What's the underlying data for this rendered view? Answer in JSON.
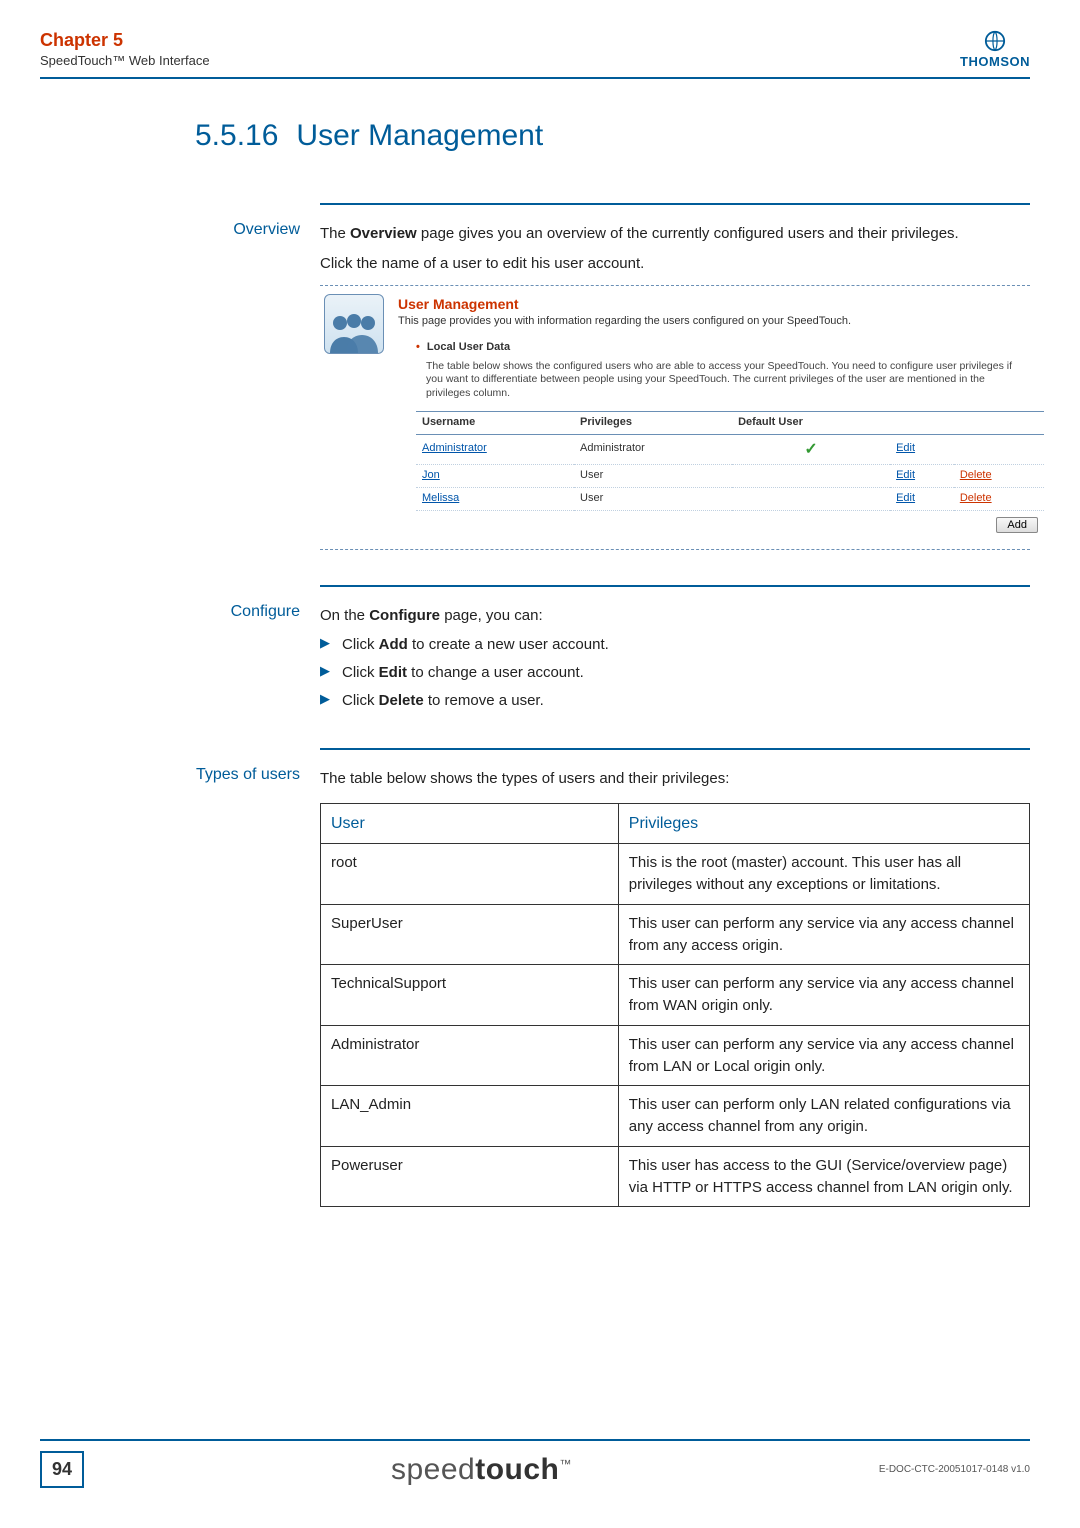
{
  "header": {
    "chapter": "Chapter 5",
    "subtitle": "SpeedTouch™ Web Interface",
    "logo_brand": "THOMSON"
  },
  "section": {
    "number": "5.5.16",
    "title": "User Management"
  },
  "overview": {
    "label": "Overview",
    "p1_prefix": "The ",
    "p1_bold": "Overview",
    "p1_suffix": " page gives you an overview of the currently configured users and their privileges.",
    "p2": "Click the name of a user to edit his user account."
  },
  "embed": {
    "title": "User Management",
    "sub": "This page provides you with information regarding the users configured on your SpeedTouch.",
    "bullet": "Local User Data",
    "desc": "The table below shows the configured users who are able to access your SpeedTouch. You need to configure user privileges if you want to differentiate between people using your SpeedTouch. The current privileges of the user are mentioned in the privileges column.",
    "cols": {
      "c1": "Username",
      "c2": "Privileges",
      "c3": "Default User"
    },
    "rows": [
      {
        "username": "Administrator",
        "priv": "Administrator",
        "default": true,
        "edit": "Edit",
        "del": ""
      },
      {
        "username": "Jon",
        "priv": "User",
        "default": false,
        "edit": "Edit",
        "del": "Delete"
      },
      {
        "username": "Melissa",
        "priv": "User",
        "default": false,
        "edit": "Edit",
        "del": "Delete"
      }
    ],
    "add_label": "Add"
  },
  "configure": {
    "label": "Configure",
    "intro_prefix": "On the ",
    "intro_bold": "Configure",
    "intro_suffix": " page, you can:",
    "items": [
      {
        "pre": "Click ",
        "bold": "Add",
        "post": " to create a new user account."
      },
      {
        "pre": "Click ",
        "bold": "Edit",
        "post": " to change a user account."
      },
      {
        "pre": "Click ",
        "bold": "Delete",
        "post": " to remove a user."
      }
    ]
  },
  "types": {
    "label": "Types of users",
    "intro": "The table below shows the types of users and their privileges:",
    "head_user": "User",
    "head_priv": "Privileges",
    "rows": [
      {
        "user": "root",
        "priv": "This is the root (master) account. This user has all privileges without any exceptions or limitations."
      },
      {
        "user": "SuperUser",
        "priv": "This user can perform any service via any access channel from any access origin."
      },
      {
        "user": "TechnicalSupport",
        "priv": "This user can perform any service via any access channel from WAN origin only."
      },
      {
        "user": "Administrator",
        "priv": "This user can perform any service via any access channel from LAN or Local origin only."
      },
      {
        "user": "LAN_Admin",
        "priv": "This user can perform only LAN related configurations via any access channel from any origin."
      },
      {
        "user": "Poweruser",
        "priv": "This user has access to the GUI (Service/overview page) via HTTP or HTTPS access channel from LAN origin only."
      }
    ]
  },
  "footer": {
    "page": "94",
    "brand_light": "speed",
    "brand_bold": "touch",
    "doc_id": "E-DOC-CTC-20051017-0148 v1.0"
  }
}
